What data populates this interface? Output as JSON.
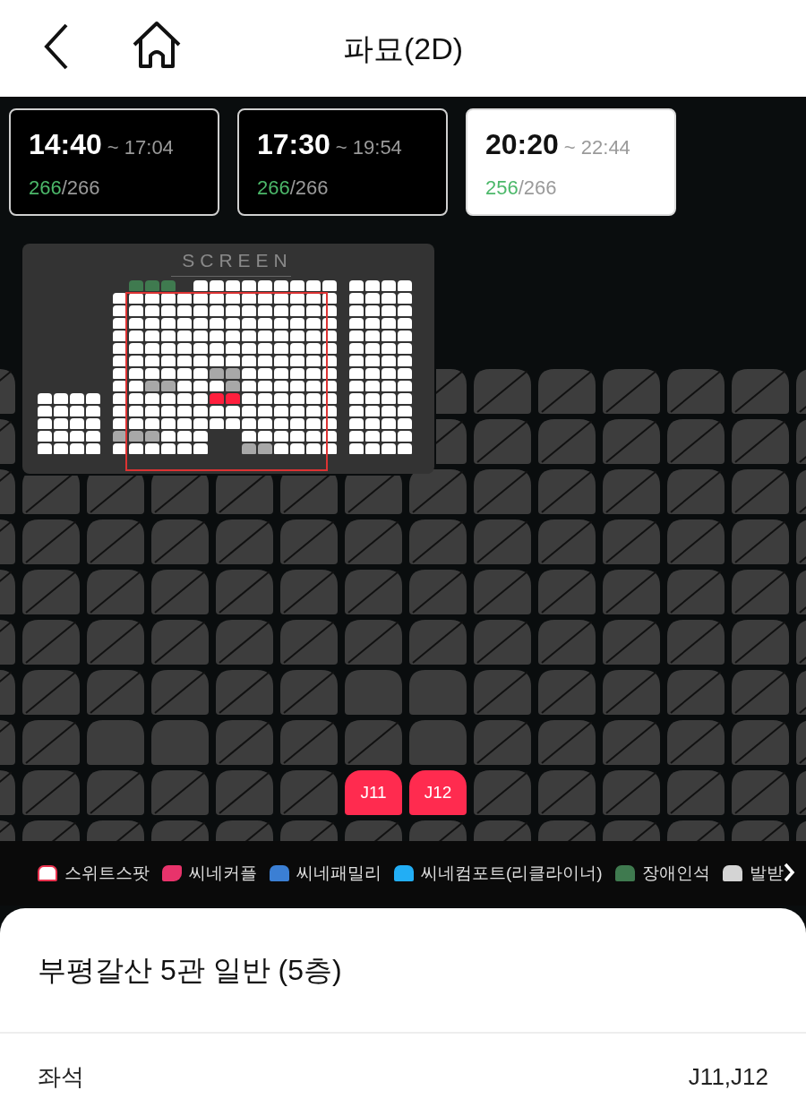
{
  "header": {
    "title": "파묘(2D)"
  },
  "showtimes": [
    {
      "start": "14:40",
      "end": "~ 17:04",
      "remaining": "266",
      "total": "/266",
      "selected": false
    },
    {
      "start": "17:30",
      "end": "~ 19:54",
      "remaining": "266",
      "total": "/266",
      "selected": false
    },
    {
      "start": "20:20",
      "end": "~ 22:44",
      "remaining": "256",
      "total": "/266",
      "selected": true
    }
  ],
  "minimap": {
    "label": "SCREEN",
    "left_block": [
      {
        "seats": [
          {
            "kind": "free"
          },
          {
            "kind": "free"
          },
          {
            "kind": "free"
          },
          {
            "kind": "free"
          }
        ]
      },
      {
        "seats": [
          {
            "kind": "free"
          },
          {
            "kind": "free"
          },
          {
            "kind": "free"
          },
          {
            "kind": "free"
          }
        ]
      },
      {
        "seats": [
          {
            "kind": "free"
          },
          {
            "kind": "free"
          },
          {
            "kind": "free"
          },
          {
            "kind": "free"
          }
        ]
      },
      {
        "seats": [
          {
            "kind": "free"
          },
          {
            "kind": "free"
          },
          {
            "kind": "free"
          },
          {
            "kind": "free"
          }
        ]
      },
      {
        "seats": [
          {
            "kind": "free"
          },
          {
            "kind": "free"
          },
          {
            "kind": "free"
          },
          {
            "kind": "free"
          }
        ]
      }
    ],
    "main_block": [
      {
        "seats": [
          {
            "kind": "gap"
          },
          {
            "kind": "accessible"
          },
          {
            "kind": "accessible"
          },
          {
            "kind": "accessible"
          },
          {
            "kind": "gap"
          },
          {
            "kind": "free"
          },
          {
            "kind": "free"
          },
          {
            "kind": "free"
          },
          {
            "kind": "free"
          },
          {
            "kind": "free"
          },
          {
            "kind": "free"
          },
          {
            "kind": "free"
          },
          {
            "kind": "free"
          },
          {
            "kind": "free"
          }
        ]
      },
      {
        "seats": [
          {
            "kind": "free"
          },
          {
            "kind": "free"
          },
          {
            "kind": "free"
          },
          {
            "kind": "free"
          },
          {
            "kind": "free"
          },
          {
            "kind": "free"
          },
          {
            "kind": "free"
          },
          {
            "kind": "free"
          },
          {
            "kind": "free"
          },
          {
            "kind": "free"
          },
          {
            "kind": "free"
          },
          {
            "kind": "free"
          },
          {
            "kind": "free"
          },
          {
            "kind": "free"
          }
        ]
      },
      {
        "seats": [
          {
            "kind": "free"
          },
          {
            "kind": "free"
          },
          {
            "kind": "free"
          },
          {
            "kind": "free"
          },
          {
            "kind": "free"
          },
          {
            "kind": "free"
          },
          {
            "kind": "free"
          },
          {
            "kind": "free"
          },
          {
            "kind": "free"
          },
          {
            "kind": "free"
          },
          {
            "kind": "free"
          },
          {
            "kind": "free"
          },
          {
            "kind": "free"
          },
          {
            "kind": "free"
          }
        ]
      },
      {
        "seats": [
          {
            "kind": "free"
          },
          {
            "kind": "free"
          },
          {
            "kind": "free"
          },
          {
            "kind": "free"
          },
          {
            "kind": "free"
          },
          {
            "kind": "free"
          },
          {
            "kind": "free"
          },
          {
            "kind": "free"
          },
          {
            "kind": "free"
          },
          {
            "kind": "free"
          },
          {
            "kind": "free"
          },
          {
            "kind": "free"
          },
          {
            "kind": "free"
          },
          {
            "kind": "free"
          }
        ]
      },
      {
        "seats": [
          {
            "kind": "free"
          },
          {
            "kind": "free"
          },
          {
            "kind": "free"
          },
          {
            "kind": "free"
          },
          {
            "kind": "free"
          },
          {
            "kind": "free"
          },
          {
            "kind": "free"
          },
          {
            "kind": "free"
          },
          {
            "kind": "free"
          },
          {
            "kind": "free"
          },
          {
            "kind": "free"
          },
          {
            "kind": "free"
          },
          {
            "kind": "free"
          },
          {
            "kind": "free"
          }
        ]
      },
      {
        "seats": [
          {
            "kind": "free"
          },
          {
            "kind": "free"
          },
          {
            "kind": "free"
          },
          {
            "kind": "free"
          },
          {
            "kind": "free"
          },
          {
            "kind": "free"
          },
          {
            "kind": "free"
          },
          {
            "kind": "free"
          },
          {
            "kind": "free"
          },
          {
            "kind": "free"
          },
          {
            "kind": "free"
          },
          {
            "kind": "free"
          },
          {
            "kind": "free"
          },
          {
            "kind": "free"
          }
        ]
      },
      {
        "seats": [
          {
            "kind": "free"
          },
          {
            "kind": "free"
          },
          {
            "kind": "free"
          },
          {
            "kind": "free"
          },
          {
            "kind": "free"
          },
          {
            "kind": "free"
          },
          {
            "kind": "free"
          },
          {
            "kind": "free"
          },
          {
            "kind": "free"
          },
          {
            "kind": "free"
          },
          {
            "kind": "free"
          },
          {
            "kind": "free"
          },
          {
            "kind": "free"
          },
          {
            "kind": "free"
          }
        ]
      },
      {
        "seats": [
          {
            "kind": "free"
          },
          {
            "kind": "free"
          },
          {
            "kind": "free"
          },
          {
            "kind": "free"
          },
          {
            "kind": "free"
          },
          {
            "kind": "free"
          },
          {
            "kind": "sold"
          },
          {
            "kind": "sold"
          },
          {
            "kind": "free"
          },
          {
            "kind": "free"
          },
          {
            "kind": "free"
          },
          {
            "kind": "free"
          },
          {
            "kind": "free"
          },
          {
            "kind": "free"
          }
        ]
      },
      {
        "seats": [
          {
            "kind": "free"
          },
          {
            "kind": "free"
          },
          {
            "kind": "sold"
          },
          {
            "kind": "sold"
          },
          {
            "kind": "free"
          },
          {
            "kind": "free"
          },
          {
            "kind": "free"
          },
          {
            "kind": "sold"
          },
          {
            "kind": "free"
          },
          {
            "kind": "free"
          },
          {
            "kind": "free"
          },
          {
            "kind": "free"
          },
          {
            "kind": "free"
          },
          {
            "kind": "free"
          }
        ]
      },
      {
        "seats": [
          {
            "kind": "free"
          },
          {
            "kind": "free"
          },
          {
            "kind": "free"
          },
          {
            "kind": "free"
          },
          {
            "kind": "free"
          },
          {
            "kind": "free"
          },
          {
            "kind": "selected",
            "label": "J11"
          },
          {
            "kind": "selected",
            "label": "J12"
          },
          {
            "kind": "free"
          },
          {
            "kind": "free"
          },
          {
            "kind": "free"
          },
          {
            "kind": "free"
          },
          {
            "kind": "free"
          },
          {
            "kind": "free"
          }
        ]
      },
      {
        "seats": [
          {
            "kind": "free"
          },
          {
            "kind": "free"
          },
          {
            "kind": "free"
          },
          {
            "kind": "free"
          },
          {
            "kind": "free"
          },
          {
            "kind": "free"
          },
          {
            "kind": "free"
          },
          {
            "kind": "free"
          },
          {
            "kind": "free"
          },
          {
            "kind": "free"
          },
          {
            "kind": "free"
          },
          {
            "kind": "free"
          },
          {
            "kind": "free"
          },
          {
            "kind": "free"
          }
        ]
      },
      {
        "seats": [
          {
            "kind": "free"
          },
          {
            "kind": "free"
          },
          {
            "kind": "free"
          },
          {
            "kind": "free"
          },
          {
            "kind": "free"
          },
          {
            "kind": "free"
          },
          {
            "kind": "free"
          },
          {
            "kind": "free"
          },
          {
            "kind": "free"
          },
          {
            "kind": "free"
          },
          {
            "kind": "free"
          },
          {
            "kind": "free"
          },
          {
            "kind": "free"
          },
          {
            "kind": "free"
          }
        ]
      },
      {
        "seats": [
          {
            "kind": "sold"
          },
          {
            "kind": "sold"
          },
          {
            "kind": "sold"
          },
          {
            "kind": "free"
          },
          {
            "kind": "free"
          },
          {
            "kind": "free"
          },
          {
            "kind": "gap"
          },
          {
            "kind": "gap"
          },
          {
            "kind": "free"
          },
          {
            "kind": "free"
          },
          {
            "kind": "free"
          },
          {
            "kind": "free"
          },
          {
            "kind": "free"
          },
          {
            "kind": "free"
          }
        ]
      },
      {
        "seats": [
          {
            "kind": "free"
          },
          {
            "kind": "free"
          },
          {
            "kind": "free"
          },
          {
            "kind": "free"
          },
          {
            "kind": "free"
          },
          {
            "kind": "free"
          },
          {
            "kind": "gap"
          },
          {
            "kind": "gap"
          },
          {
            "kind": "sold"
          },
          {
            "kind": "sold"
          },
          {
            "kind": "free"
          },
          {
            "kind": "free"
          },
          {
            "kind": "free"
          },
          {
            "kind": "free"
          }
        ]
      }
    ],
    "right_block": [
      {
        "seats": [
          {
            "kind": "free"
          },
          {
            "kind": "free"
          },
          {
            "kind": "free"
          },
          {
            "kind": "free"
          }
        ]
      },
      {
        "seats": [
          {
            "kind": "free"
          },
          {
            "kind": "free"
          },
          {
            "kind": "free"
          },
          {
            "kind": "free"
          }
        ]
      },
      {
        "seats": [
          {
            "kind": "free"
          },
          {
            "kind": "free"
          },
          {
            "kind": "free"
          },
          {
            "kind": "free"
          }
        ]
      },
      {
        "seats": [
          {
            "kind": "free"
          },
          {
            "kind": "free"
          },
          {
            "kind": "free"
          },
          {
            "kind": "free"
          }
        ]
      },
      {
        "seats": [
          {
            "kind": "free"
          },
          {
            "kind": "free"
          },
          {
            "kind": "free"
          },
          {
            "kind": "free"
          }
        ]
      },
      {
        "seats": [
          {
            "kind": "free"
          },
          {
            "kind": "free"
          },
          {
            "kind": "free"
          },
          {
            "kind": "free"
          }
        ]
      },
      {
        "seats": [
          {
            "kind": "free"
          },
          {
            "kind": "free"
          },
          {
            "kind": "free"
          },
          {
            "kind": "free"
          }
        ]
      },
      {
        "seats": [
          {
            "kind": "free"
          },
          {
            "kind": "free"
          },
          {
            "kind": "free"
          },
          {
            "kind": "free"
          }
        ]
      },
      {
        "seats": [
          {
            "kind": "free"
          },
          {
            "kind": "free"
          },
          {
            "kind": "free"
          },
          {
            "kind": "free"
          }
        ]
      },
      {
        "seats": [
          {
            "kind": "free"
          },
          {
            "kind": "free"
          },
          {
            "kind": "free"
          },
          {
            "kind": "free"
          }
        ]
      },
      {
        "seats": [
          {
            "kind": "free"
          },
          {
            "kind": "free"
          },
          {
            "kind": "free"
          },
          {
            "kind": "free"
          }
        ]
      },
      {
        "seats": [
          {
            "kind": "free"
          },
          {
            "kind": "free"
          },
          {
            "kind": "free"
          },
          {
            "kind": "free"
          }
        ]
      },
      {
        "seats": [
          {
            "kind": "free"
          },
          {
            "kind": "free"
          },
          {
            "kind": "free"
          },
          {
            "kind": "free"
          }
        ]
      },
      {
        "seats": [
          {
            "kind": "free"
          },
          {
            "kind": "free"
          },
          {
            "kind": "free"
          },
          {
            "kind": "free"
          }
        ]
      }
    ]
  },
  "legend": [
    {
      "label": "스위트스팟",
      "kind": "outline",
      "color": "#e8334f"
    },
    {
      "label": "씨네커플",
      "kind": "couple",
      "color": "#e8336b"
    },
    {
      "label": "씨네패밀리",
      "kind": "fill",
      "color": "#3b7fd4"
    },
    {
      "label": "씨네컴포트(리클라이너)",
      "kind": "fill",
      "color": "#22aef5"
    },
    {
      "label": "장애인석",
      "kind": "fill",
      "color": "#3f7a4f"
    },
    {
      "label": "발받",
      "kind": "fill",
      "color": "#d4d4d4"
    }
  ],
  "hall": {
    "title": "부평갈산 5관 일반 (5층)"
  },
  "summary": [
    {
      "label": "좌석",
      "value": "J11,J12"
    }
  ]
}
